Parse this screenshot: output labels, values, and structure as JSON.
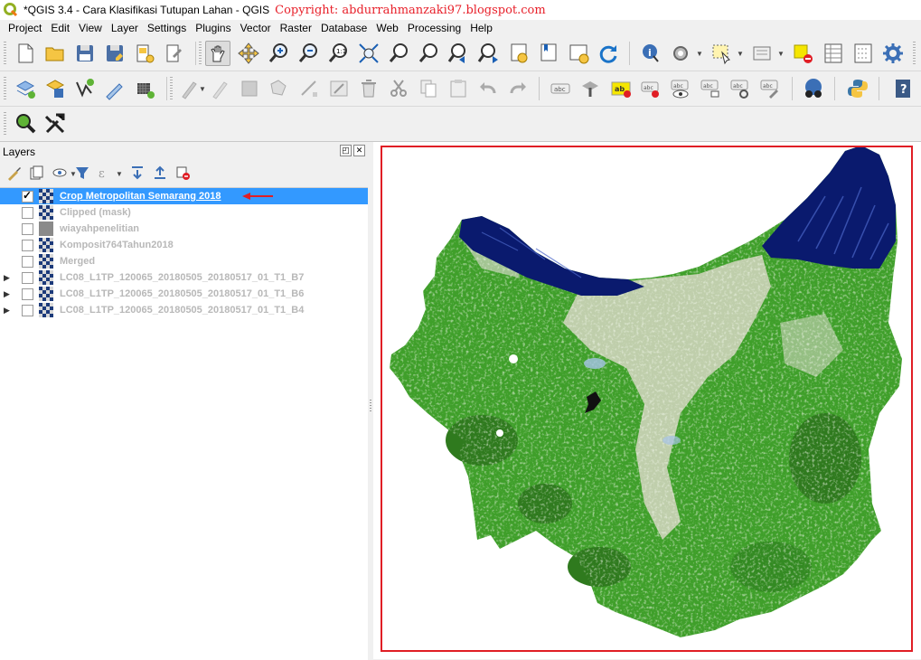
{
  "window": {
    "title": "*QGIS 3.4 - Cara Klasifikasi Tutupan Lahan - QGIS",
    "watermark": "Copyright: abdurrahmanzaki97.blogspot.com"
  },
  "menu": [
    "Project",
    "Edit",
    "View",
    "Layer",
    "Settings",
    "Plugins",
    "Vector",
    "Raster",
    "Database",
    "Web",
    "Processing",
    "Help"
  ],
  "layers_panel": {
    "title": "Layers",
    "layers": [
      {
        "name": "Crop Metropolitan Semarang 2018",
        "checked": true,
        "selected": true,
        "expandable": false,
        "icon": "raster-layer-icon"
      },
      {
        "name": "Clipped (mask)",
        "checked": false,
        "selected": false,
        "expandable": false,
        "icon": "raster-layer-icon"
      },
      {
        "name": "wiayahpenelitian",
        "checked": false,
        "selected": false,
        "expandable": false,
        "icon": "single-band-raster-icon"
      },
      {
        "name": "Komposit764Tahun2018",
        "checked": false,
        "selected": false,
        "expandable": false,
        "icon": "raster-layer-icon"
      },
      {
        "name": "Merged",
        "checked": false,
        "selected": false,
        "expandable": false,
        "icon": "raster-layer-icon"
      },
      {
        "name": "LC08_L1TP_120065_20180505_20180517_01_T1_B7",
        "checked": false,
        "selected": false,
        "expandable": true,
        "icon": "raster-layer-icon"
      },
      {
        "name": "LC08_L1TP_120065_20180505_20180517_01_T1_B6",
        "checked": false,
        "selected": false,
        "expandable": true,
        "icon": "raster-layer-icon"
      },
      {
        "name": "LC08_L1TP_120065_20180505_20180517_01_T1_B4",
        "checked": false,
        "selected": false,
        "expandable": true,
        "icon": "raster-layer-icon"
      }
    ]
  },
  "colors": {
    "selection": "#3399ff",
    "annotation_red": "#e01e25",
    "vegetation": "#3f9f2a",
    "water": "#0a1a6e",
    "urban": "#d8d8c8"
  }
}
